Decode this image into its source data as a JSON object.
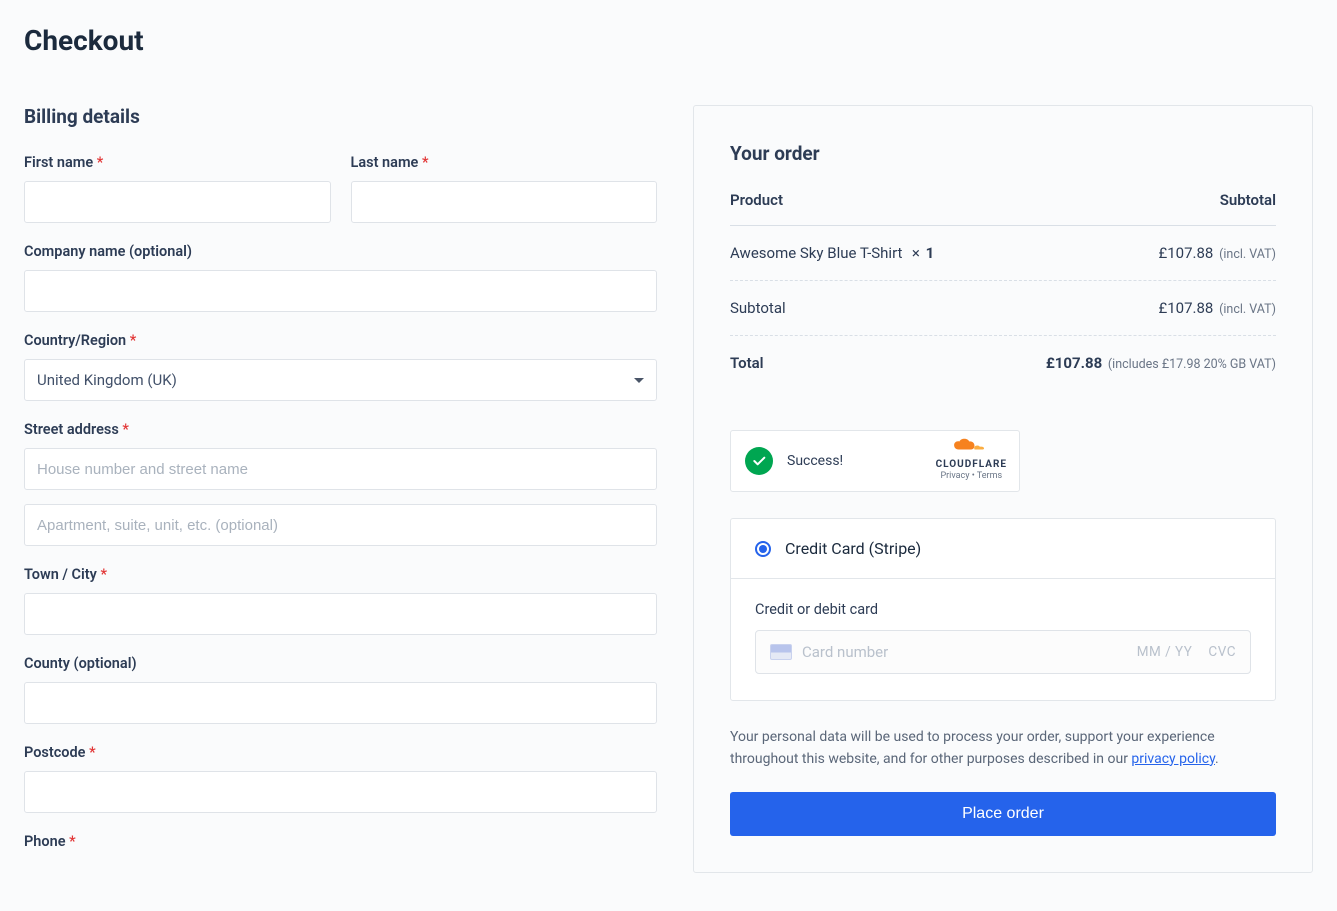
{
  "page": {
    "title": "Checkout"
  },
  "billing": {
    "section_title": "Billing details",
    "first_name_label": "First name",
    "last_name_label": "Last name",
    "company_label": "Company name (optional)",
    "country_label": "Country/Region",
    "country_value": "United Kingdom (UK)",
    "street_label": "Street address",
    "street_placeholder_1": "House number and street name",
    "street_placeholder_2": "Apartment, suite, unit, etc. (optional)",
    "city_label": "Town / City",
    "county_label": "County (optional)",
    "postcode_label": "Postcode",
    "phone_label": "Phone",
    "required_mark": "*"
  },
  "order": {
    "title": "Your order",
    "header_product": "Product",
    "header_subtotal": "Subtotal",
    "line_item": {
      "name": "Awesome Sky Blue T-Shirt",
      "qty_x": "×",
      "qty": "1",
      "price": "£107.88",
      "vat_note": "(incl. VAT)"
    },
    "subtotal_label": "Subtotal",
    "subtotal_price": "£107.88",
    "subtotal_vat_note": "(incl. VAT)",
    "total_label": "Total",
    "total_price": "£107.88",
    "total_tax_note": "(includes £17.98 20% GB VAT)"
  },
  "captcha": {
    "status": "Success!",
    "brand": "CLOUDFLARE",
    "links": "Privacy • Terms"
  },
  "payment": {
    "method_label": "Credit Card (Stripe)",
    "card_label": "Credit or debit card",
    "card_placeholder": "Card number",
    "exp_placeholder": "MM / YY",
    "cvc_placeholder": "CVC"
  },
  "privacy": {
    "text_before": "Your personal data will be used to process your order, support your experience throughout this website, and for other purposes described in our ",
    "link_text": "privacy policy",
    "text_after": "."
  },
  "actions": {
    "place_order": "Place order"
  }
}
